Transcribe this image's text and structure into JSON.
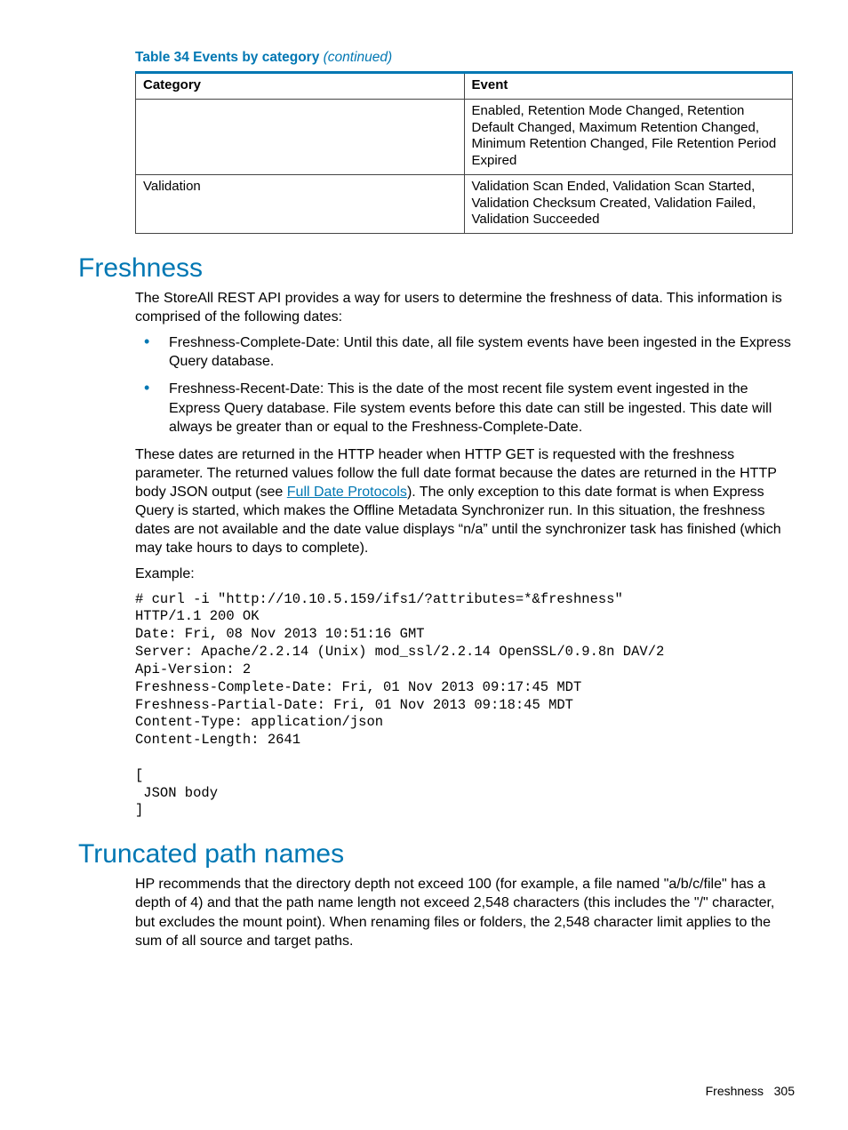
{
  "table": {
    "caption_prefix": "Table 34 Events by category ",
    "caption_suffix": "(continued)",
    "headers": [
      "Category",
      "Event"
    ],
    "rows": [
      {
        "category": "",
        "event": "Enabled, Retention Mode Changed, Retention Default Changed, Maximum Retention Changed, Minimum Retention Changed, File Retention Period Expired"
      },
      {
        "category": "Validation",
        "event": "Validation Scan Ended, Validation Scan Started, Validation Checksum Created, Validation Failed, Validation Succeeded"
      }
    ]
  },
  "freshness": {
    "heading": "Freshness",
    "intro": "The StoreAll REST API provides a way for users to determine the freshness of data. This information is comprised of the following dates:",
    "bullets": [
      "Freshness-Complete-Date: Until this date, all file system events have been ingested in the Express Query database.",
      "Freshness-Recent-Date: This is the date of the most recent file system event ingested in the Express Query database. File system events before this date can still be ingested. This date will always be greater than or equal to the Freshness-Complete-Date."
    ],
    "para2_pre": "These dates are returned in the HTTP header when HTTP GET is requested with the freshness parameter. The returned values follow the full date format because the dates are returned in the HTTP body JSON output (see ",
    "link_text": "Full Date Protocols",
    "para2_post": "). The only exception to this date format is when Express Query is started, which makes the Offline Metadata Synchronizer run. In this situation, the freshness dates are not available and the date value displays “n/a” until the synchronizer task has finished (which may take hours to days to complete).",
    "example_label": "Example:",
    "code": "# curl -i \"http://10.10.5.159/ifs1/?attributes=*&freshness\"\nHTTP/1.1 200 OK\nDate: Fri, 08 Nov 2013 10:51:16 GMT\nServer: Apache/2.2.14 (Unix) mod_ssl/2.2.14 OpenSSL/0.9.8n DAV/2\nApi-Version: 2\nFreshness-Complete-Date: Fri, 01 Nov 2013 09:17:45 MDT\nFreshness-Partial-Date: Fri, 01 Nov 2013 09:18:45 MDT\nContent-Type: application/json\nContent-Length: 2641\n\n[\n JSON body\n]"
  },
  "truncated": {
    "heading": "Truncated path names",
    "para": "HP recommends that the directory depth not exceed 100 (for example, a file named \"a/b/c/file\" has a depth of 4) and that the path name length not exceed 2,548 characters (this includes the \"/\" character, but excludes the mount point). When renaming files or folders, the 2,548 character limit applies to the sum of all source and target paths."
  },
  "footer": {
    "section": "Freshness",
    "page": "305"
  }
}
